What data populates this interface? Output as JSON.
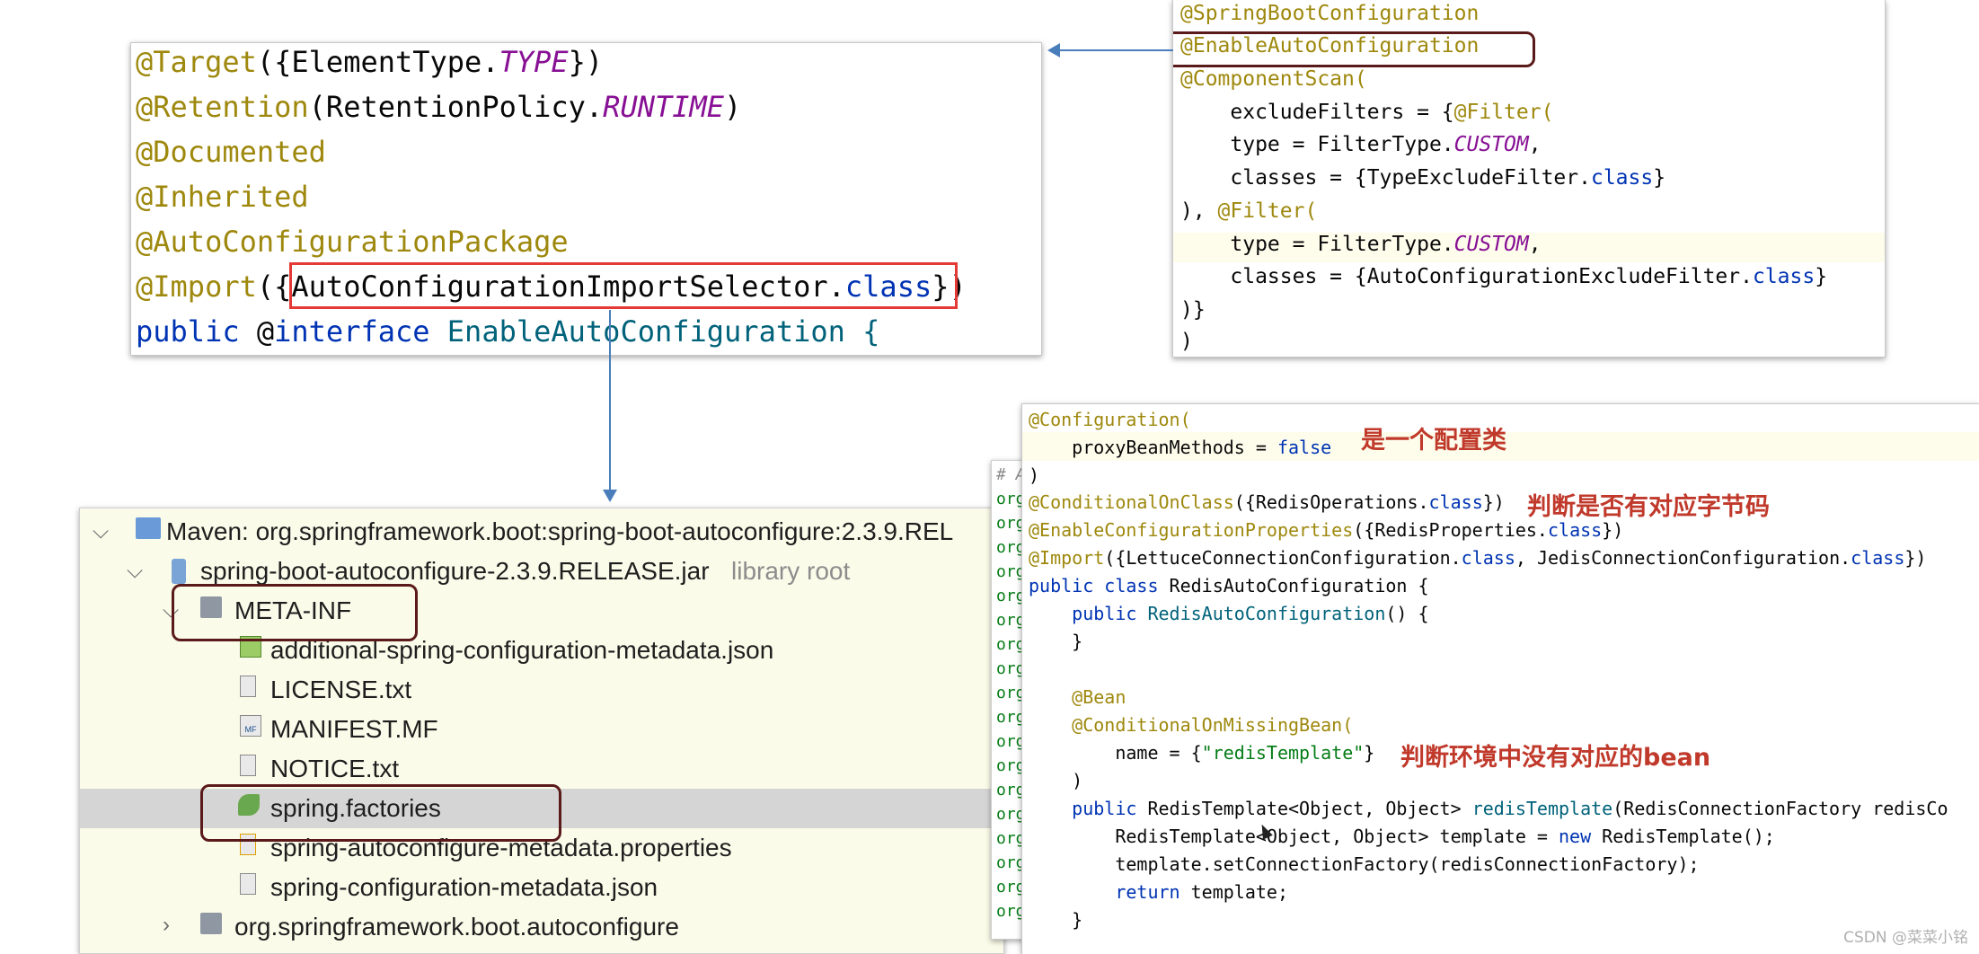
{
  "panel_a": {
    "lines": [
      [
        "@Target({ElementType.",
        "TYPE",
        "})"
      ],
      [
        "@Retention(RetentionPolicy.",
        "RUNTIME",
        ")"
      ],
      [
        "@Documented"
      ],
      [
        "@Inherited"
      ],
      [
        "@AutoConfigurationPackage"
      ],
      [
        "@Import({",
        "AutoConfigurationImportSelector.",
        "class",
        "})"
      ],
      [
        "public",
        " @",
        "interface",
        " EnableAutoConfiguration {"
      ]
    ]
  },
  "panel_b": {
    "lines": [
      "@SpringBootConfiguration",
      "@EnableAutoConfiguration",
      "@ComponentScan(",
      "    excludeFilters = {",
      "@Filter(",
      "    type = FilterType.",
      "CUSTOM",
      ",",
      "    classes = {TypeExcludeFilter.",
      "class",
      "}",
      "), ",
      "    type = FilterType.",
      "CUSTOM",
      ",",
      "    classes = {AutoConfigurationExcludeFilter.",
      "class",
      "}",
      ")}",
      ")"
    ]
  },
  "tree": {
    "maven_row": "Maven: org.springframework.boot:spring-boot-autoconfigure:2.3.9.REL",
    "jar_row": "spring-boot-autoconfigure-2.3.9.RELEASE.jar",
    "jar_suffix": "library root",
    "meta_inf": "META-INF",
    "files": [
      "additional-spring-configuration-metadata.json",
      "LICENSE.txt",
      "MANIFEST.MF",
      "NOTICE.txt",
      "spring.factories",
      "spring-autoconfigure-metadata.properties",
      "spring-configuration-metadata.json"
    ],
    "package_row": "org.springframework.boot.autoconfigure",
    "manifest_icon_text": "MF"
  },
  "panel_d": {
    "hash_line": "# A",
    "org_prefix": "org"
  },
  "panel_e": {
    "l1": "@Configuration(",
    "l2a": "    proxyBeanMethods = ",
    "l2b": "false",
    "l3": ")",
    "l4a": "@ConditionalOnClass({RedisOperations.",
    "l4b": "class",
    "l4c": "})",
    "l5a": "@EnableConfigurationProperties({RedisProperties.",
    "l5b": "class",
    "l5c": "})",
    "l6a": "@Import({LettuceConnectionConfiguration.",
    "l6b": "class",
    "l6c": ", JedisConnectionConfiguration.",
    "l6d": "class",
    "l6e": "})",
    "l7a": "public class",
    "l7b": " RedisAutoConfiguration {",
    "l8a": "    public ",
    "l8b": "RedisAutoConfiguration",
    "l8c": "() {",
    "l9": "    }",
    "l11": "    @Bean",
    "l12": "    @ConditionalOnMissingBean(",
    "l13a": "        name = {",
    "l13b": "\"redisTemplate\"",
    "l13c": "}",
    "l14": "    )",
    "l15a": "    public ",
    "l15b": "RedisTemplate<Object, Object> ",
    "l15c": "redisTemplate",
    "l15d": "(RedisConnectionFactory redisCo",
    "l16a": "        RedisTemplate<Object, Object> template = ",
    "l16b": "new",
    "l16c": " RedisTemplate();",
    "l17": "        template.setConnectionFactory(redisConnectionFactory);",
    "l18a": "        ",
    "l18b": "return",
    "l18c": " template;",
    "l19": "    }"
  },
  "notes": {
    "config_class": "是一个配置类",
    "check_bytecode": "判断是否有对应字节码",
    "check_bean": "判断环境中没有对应的bean"
  },
  "watermark": "CSDN @菜菜小铭"
}
